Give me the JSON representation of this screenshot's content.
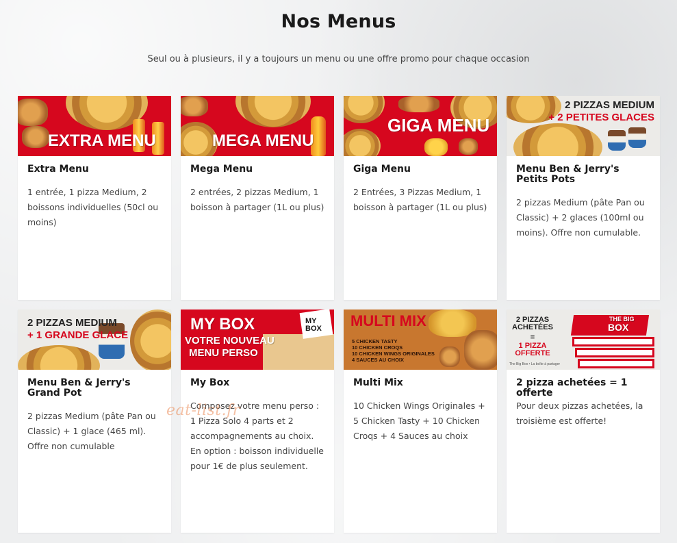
{
  "page": {
    "title": "Nos Menus",
    "subtitle": "Seul ou à plusieurs, il y a toujours un menu ou une offre promo pour chaque occasion",
    "watermark": "eat-list.fr"
  },
  "colors": {
    "brand_red": "#d6071e",
    "card_bg": "#ffffff",
    "page_bg": "#eeeff0"
  },
  "cards": [
    {
      "title": "Extra Menu",
      "banner_text": "EXTRA MENU",
      "description": "1 entrée, 1 pizza Medium, 2 boissons individuelles (50cl ou moins)"
    },
    {
      "title": "Mega Menu",
      "banner_text": "MEGA MENU",
      "description": "2 entrées, 2 pizzas Medium, 1 boisson à partager (1L ou plus)"
    },
    {
      "title": "Giga Menu",
      "banner_text": "GIGA MENU",
      "description": "2 Entrées, 3 Pizzas Medium, 1 boisson à partager (1L ou plus)"
    },
    {
      "title": "Menu Ben & Jerry's Petits Pots",
      "banner_text_1": "2 PIZZAS MEDIUM",
      "banner_text_2": "+ 2 PETITES GLACES",
      "description": "2 pizzas Medium (pâte Pan ou Classic) + 2 glaces (100ml ou moins). Offre non cumulable."
    },
    {
      "title": "Menu Ben & Jerry's Grand Pot",
      "banner_text_1": "2 PIZZAS MEDIUM",
      "banner_text_2": "+ 1 GRANDE GLACE",
      "description": "2 pizzas Medium (pâte Pan ou Classic) + 1 glace (465 ml). Offre non cumulable"
    },
    {
      "title": "My Box",
      "banner_text_1": "MY BOX",
      "banner_text_2": "VOTRE NOUVEAU",
      "banner_text_3": "MENU PERSO",
      "box_label": "MY BOX",
      "description": "Composez votre menu perso : 1 Pizza Solo 4 parts et 2 accompagnements au choix. En option : boisson individuelle pour 1€ de plus seulement."
    },
    {
      "title": "Multi Mix",
      "banner_text": "MULTI MIX",
      "banner_list": [
        "5 CHICKEN TASTY",
        "10 CHICKEN CROQS",
        "10 CHICKEN WINGS ORIGINALES",
        "4 SAUCES AU CHOIX"
      ],
      "description": "10 Chicken Wings Originales + 5 Chicken Tasty + 10 Chicken Croqs + 4 Sauces au choix"
    },
    {
      "title": "2 pizza achetées = 1 offerte",
      "banner_text_1": "2 PIZZAS ACHETÉES",
      "banner_text_2": "=",
      "banner_text_3": "1 PIZZA OFFERTE",
      "box_label_1": "THE BIG",
      "box_label_2": "BOX",
      "fine_print": "The Big Box • La boîte à partager",
      "description": "Pour deux pizzas achetées, la troisième est offerte!"
    }
  ]
}
